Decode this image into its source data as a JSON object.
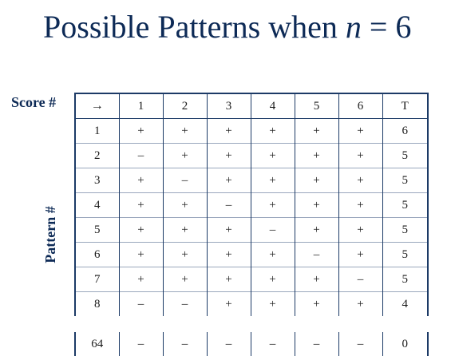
{
  "title": {
    "prefix": "Possible Patterns when ",
    "variable": "n",
    "suffix": " = 6"
  },
  "labels": {
    "score": "Score #",
    "pattern": "Pattern #"
  },
  "header": [
    "→",
    "1",
    "2",
    "3",
    "4",
    "5",
    "6",
    "T"
  ],
  "rows": [
    [
      "1",
      "+",
      "+",
      "+",
      "+",
      "+",
      "+",
      "6"
    ],
    [
      "2",
      "–",
      "+",
      "+",
      "+",
      "+",
      "+",
      "5"
    ],
    [
      "3",
      "+",
      "–",
      "+",
      "+",
      "+",
      "+",
      "5"
    ],
    [
      "4",
      "+",
      "+",
      "–",
      "+",
      "+",
      "+",
      "5"
    ],
    [
      "5",
      "+",
      "+",
      "+",
      "–",
      "+",
      "+",
      "5"
    ],
    [
      "6",
      "+",
      "+",
      "+",
      "+",
      "–",
      "+",
      "5"
    ],
    [
      "7",
      "+",
      "+",
      "+",
      "+",
      "+",
      "–",
      "5"
    ],
    [
      "8",
      "–",
      "–",
      "+",
      "+",
      "+",
      "+",
      "4"
    ]
  ],
  "last_row": [
    "64",
    "–",
    "–",
    "–",
    "–",
    "–",
    "–",
    "0"
  ]
}
